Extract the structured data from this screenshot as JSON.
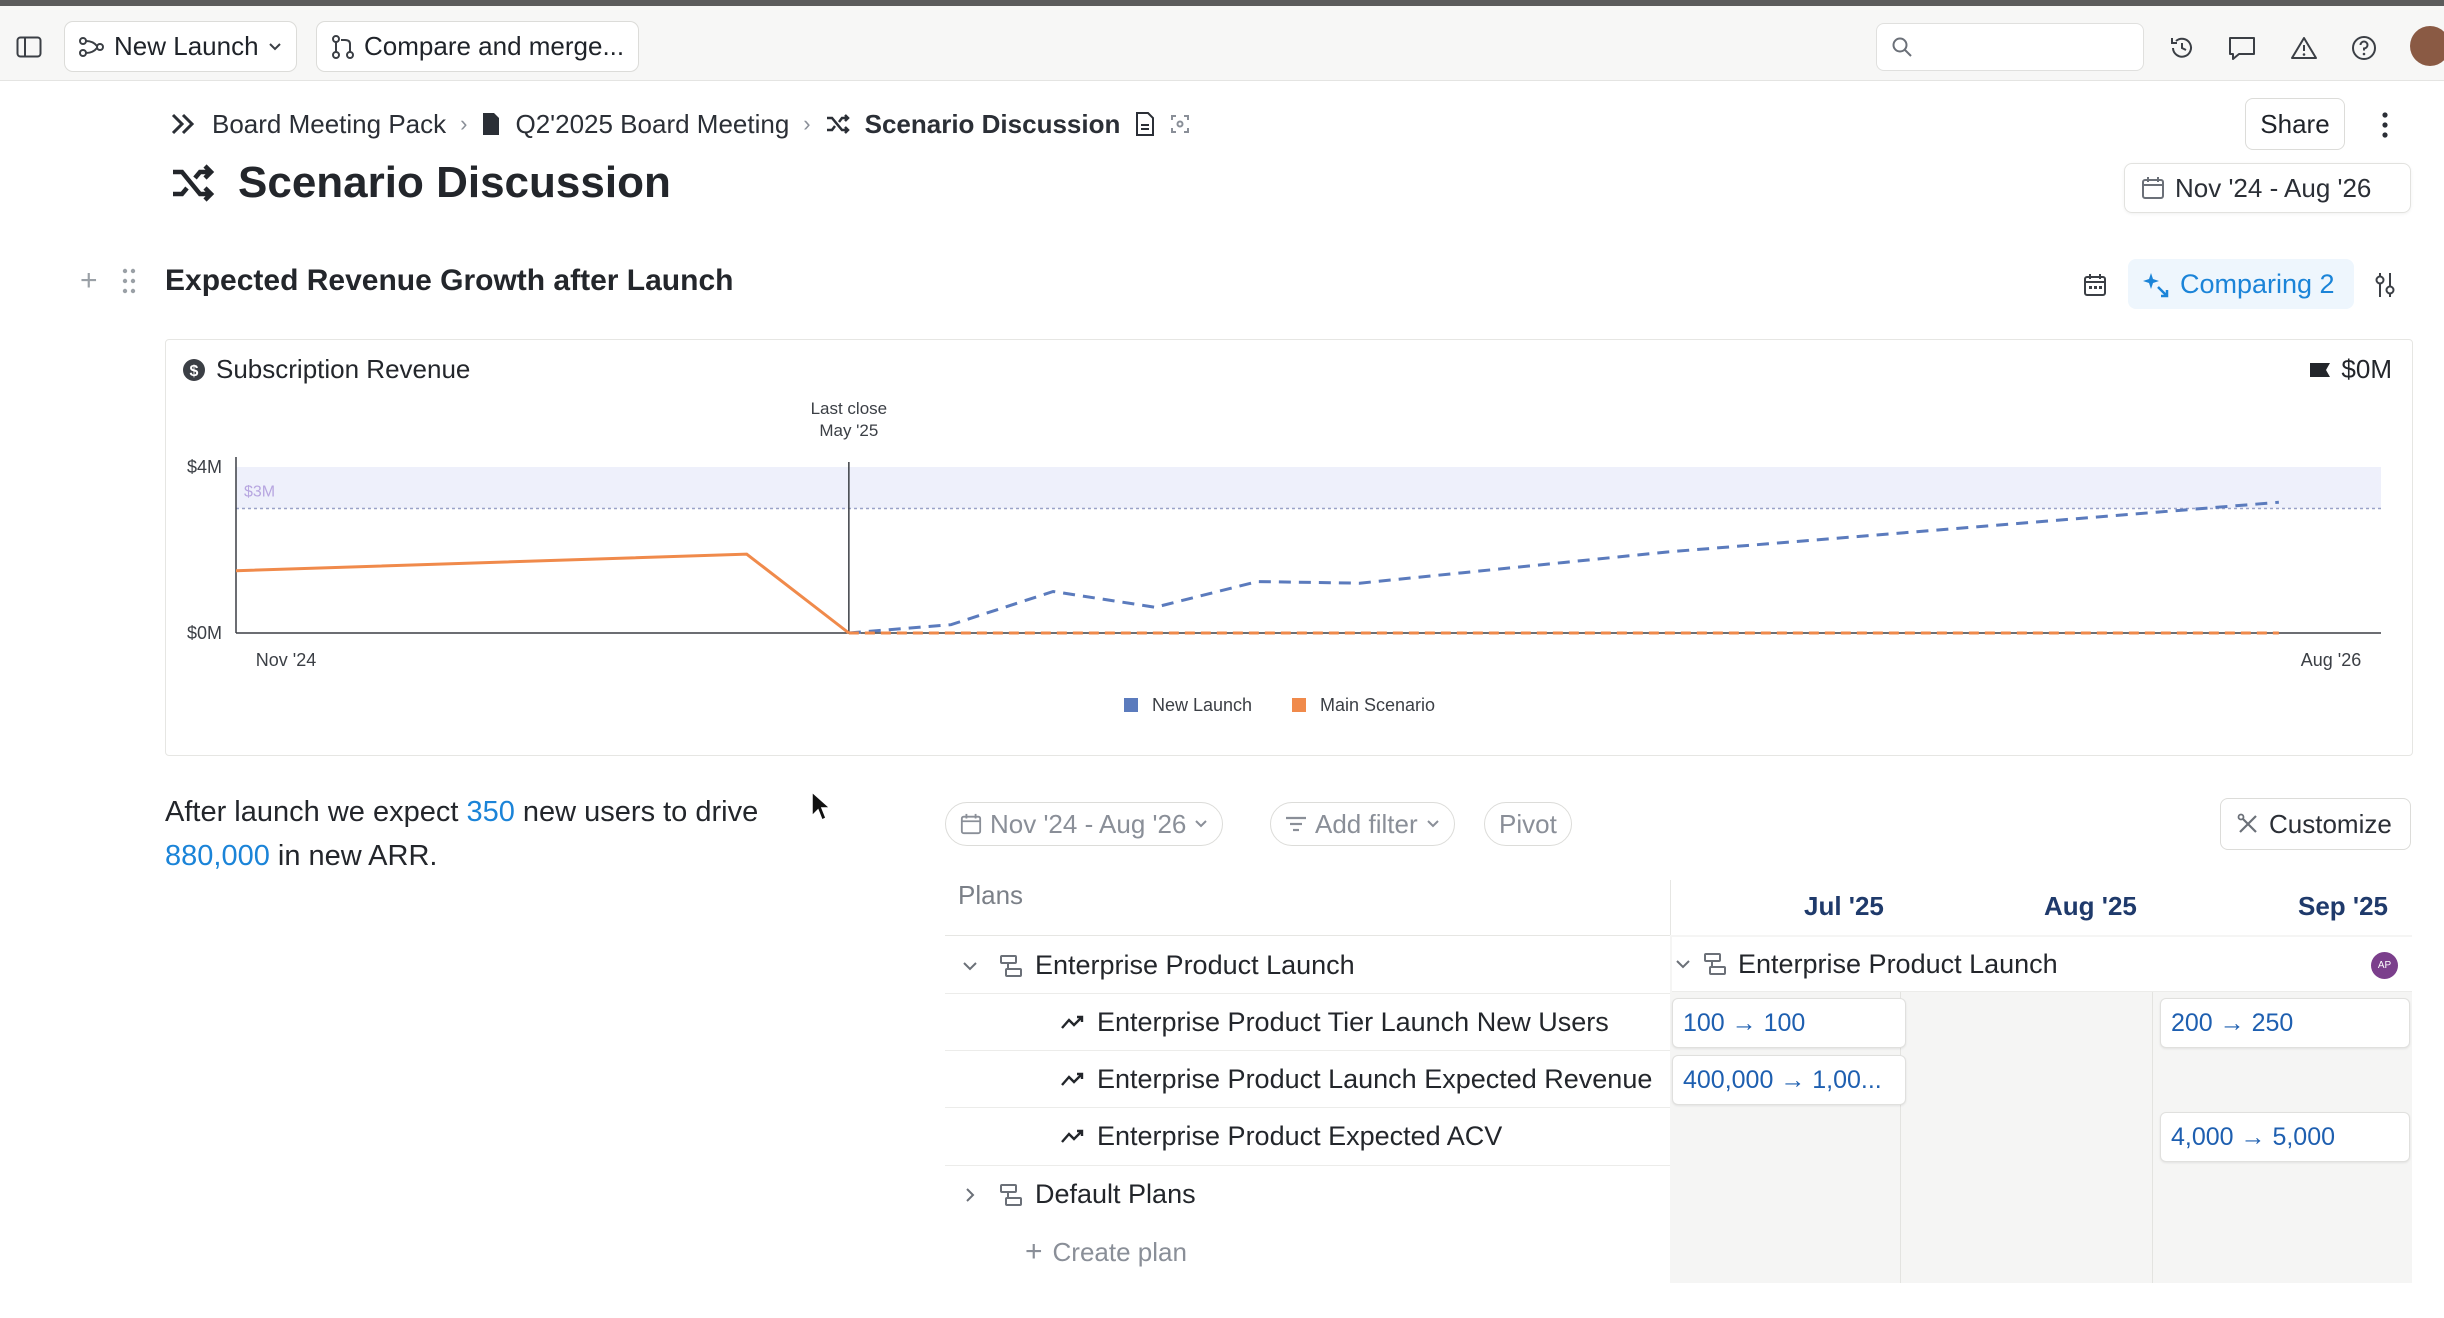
{
  "topbar": {
    "branch_label": "New Launch",
    "compare_label": "Compare and merge...",
    "search_placeholder": ""
  },
  "breadcrumb": {
    "items": [
      "Board Meeting Pack",
      "Q2'2025 Board Meeting",
      "Scenario Discussion"
    ]
  },
  "page": {
    "title": "Scenario Discussion",
    "share_label": "Share",
    "date_range": "Nov '24  -  Aug '26"
  },
  "section": {
    "title": "Expected Revenue Growth after Launch",
    "comparing_label": "Comparing 2"
  },
  "chart_data": {
    "type": "line",
    "title": "Subscription Revenue",
    "total_label": "$0M",
    "xlabel": "",
    "ylabel": "",
    "x_start_label": "Nov '24",
    "x_end_label": "Aug '26",
    "y_ticks": [
      "$4M",
      "$0M"
    ],
    "ylim": [
      0,
      4
    ],
    "x_range": [
      0,
      21
    ],
    "target_band_label": "$3M",
    "target_value": 3,
    "annotation": {
      "line1": "Last close",
      "line2": "May '25",
      "x": 6
    },
    "legend_position": "bottom",
    "series": [
      {
        "name": "New Launch",
        "color": "#5b7bbd",
        "dashed": true,
        "x": [
          6,
          7,
          8,
          9,
          10,
          11,
          12,
          13,
          14,
          15,
          16,
          17,
          18,
          19,
          20
        ],
        "y": [
          0.0,
          0.2,
          1.0,
          0.62,
          1.24,
          1.2,
          1.45,
          1.7,
          1.95,
          2.15,
          2.35,
          2.55,
          2.75,
          2.95,
          3.15
        ]
      },
      {
        "name": "Main Scenario",
        "color": "#f08a4b",
        "dashed": false,
        "x": [
          0,
          5,
          6
        ],
        "y": [
          1.5,
          1.9,
          0.0
        ],
        "dashed_x": [
          6,
          20
        ],
        "dashed_y": [
          0.0,
          0.0
        ]
      }
    ]
  },
  "narrative": {
    "p1": "After launch we expect ",
    "users": "350",
    "p2": " new users to drive ",
    "arr": "880,000",
    "p3": " in new ARR."
  },
  "filters": {
    "date_range": "Nov '24  -  Aug '26",
    "add_filter": "Add filter",
    "pivot": "Pivot",
    "customize": "Customize"
  },
  "plans": {
    "header": "Plans",
    "months": [
      "Jul '25",
      "Aug '25",
      "Sep '25"
    ],
    "rows": [
      {
        "label": "Enterprise Product Launch"
      },
      {
        "label": "Enterprise Product Tier Launch New Users"
      },
      {
        "label": "Enterprise Product Launch Expected Revenue"
      },
      {
        "label": "Enterprise Product Expected ACV"
      },
      {
        "label": "Default Plans"
      }
    ],
    "create_plan": "Create plan",
    "timeline_plan": "Enterprise Product Launch",
    "avatar_initials": "AP",
    "cells": {
      "users_jul": "100 → 100",
      "users_sep": "200 → 250",
      "revenue_jul": "400,000 → 1,00...",
      "acv_sep": "4,000 → 5,000"
    }
  },
  "colors": {
    "accent": "#1b84d8",
    "new_launch": "#5b7bbd",
    "main_scenario": "#f08a4b"
  }
}
